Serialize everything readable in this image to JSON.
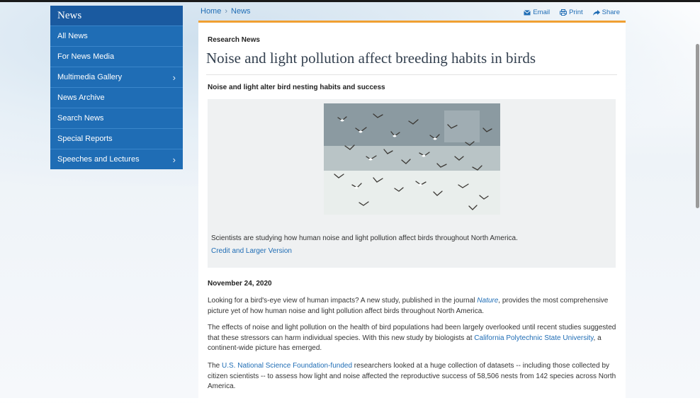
{
  "sidebar": {
    "heading": "News",
    "items": [
      {
        "label": "All News",
        "has_submenu": false
      },
      {
        "label": "For News Media",
        "has_submenu": false
      },
      {
        "label": "Multimedia Gallery",
        "has_submenu": true
      },
      {
        "label": "News Archive",
        "has_submenu": false
      },
      {
        "label": "Search News",
        "has_submenu": false
      },
      {
        "label": "Special Reports",
        "has_submenu": false
      },
      {
        "label": "Speeches and Lectures",
        "has_submenu": true
      }
    ]
  },
  "breadcrumb": {
    "home": "Home",
    "separator": "›",
    "current": "News"
  },
  "tools": {
    "email": "Email",
    "print": "Print",
    "share": "Share"
  },
  "article": {
    "section": "Research News",
    "title": "Noise and light pollution affect breeding habits in birds",
    "subtitle": "Noise and light alter bird nesting habits and success",
    "image_caption": "Scientists are studying how human noise and light pollution affect birds throughout North America.",
    "credit_link": "Credit and Larger Version",
    "date": "November 24, 2020",
    "p1_before": "Looking for a bird's-eye view of human impacts? A new study, published in the journal ",
    "p1_link": "Nature",
    "p1_after": ", provides the most comprehensive picture yet of how human noise and light pollution affect birds throughout North America.",
    "p2_before": "The effects of noise and light pollution on the health of bird populations had been largely overlooked until recent studies suggested that these stressors can harm individual species. With this new study by biologists at ",
    "p2_link": "California Polytechnic State University",
    "p2_after": ", a continent-wide picture has emerged.",
    "p3_link": "U.S. National Science Foundation-funded",
    "p3_before": "The ",
    "p3_after": " researchers looked at a huge collection of datasets -- including those collected by citizen scientists -- to assess how light and noise affected the reproductive success of 58,506 nests from 142 species across North America."
  },
  "colors": {
    "accent": "#f0a032",
    "brand": "#1f6db5",
    "sidebar_head": "#1a5aa0"
  }
}
